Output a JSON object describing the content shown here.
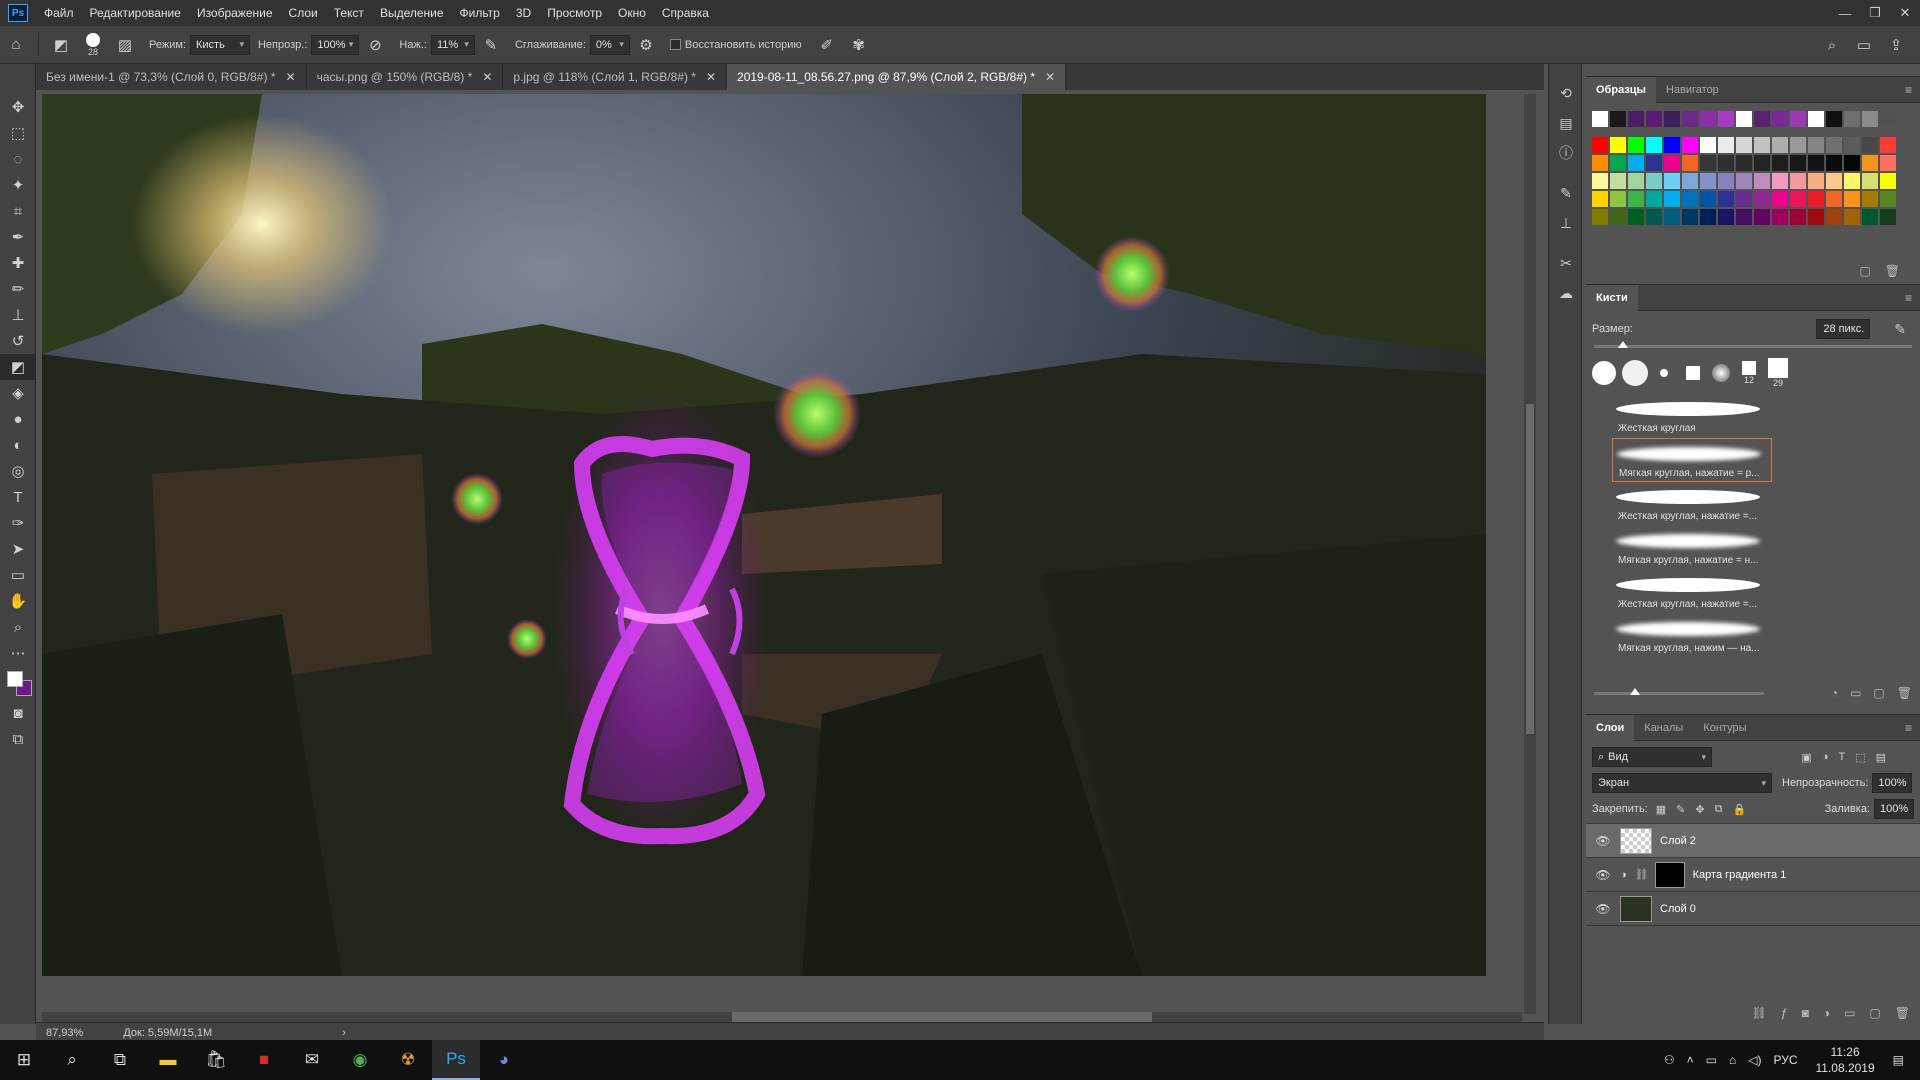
{
  "app": {
    "logo": "Ps"
  },
  "menu": [
    "Файл",
    "Редактирование",
    "Изображение",
    "Слои",
    "Текст",
    "Выделение",
    "Фильтр",
    "3D",
    "Просмотр",
    "Окно",
    "Справка"
  ],
  "window_controls": {
    "minimize": "—",
    "restore": "❐",
    "close": "✕"
  },
  "options": {
    "brush_size": "28",
    "mode_label": "Режим:",
    "mode_value": "Кисть",
    "opacity_label": "Непрозр.:",
    "opacity_value": "100%",
    "pressure_label": "Наж.:",
    "pressure_value": "11%",
    "smoothing_label": "Сглаживание:",
    "smoothing_value": "0%",
    "restore_history": "Восстановить историю"
  },
  "tabs": [
    {
      "label": "Без имени-1 @ 73,3% (Слой 0, RGB/8#) *",
      "active": false
    },
    {
      "label": "часы.png @ 150% (RGB/8) *",
      "active": false
    },
    {
      "label": "p.jpg @ 118% (Слой 1, RGB/8#) *",
      "active": false
    },
    {
      "label": "2019-08-11_08.56.27.png @ 87,9% (Слой 2, RGB/8#) *",
      "active": true
    }
  ],
  "status": {
    "zoom": "87,93%",
    "doc": "Док: 5,59M/15,1M"
  },
  "swatches_panel": {
    "tabs": [
      "Образцы",
      "Навигатор"
    ]
  },
  "swatch_rows": [
    [
      "#ffffff",
      "#1a1a1a",
      "#4b1e63",
      "#5a1a78",
      "#3c1e5a",
      "#6b2a86",
      "#8a2fa8",
      "#a33cc2",
      "#ffffff",
      "#5c2070",
      "#7a2a96",
      "#9a3ab6",
      "#ffffff",
      "#101010",
      "#6e6e6e",
      "#8a8a8a",
      "#505050"
    ],
    [
      "#ff0000",
      "#ffff00",
      "#00ff00",
      "#00ffff",
      "#0000ff",
      "#ff00ff",
      "#ffffff",
      "#ebebeb",
      "#d6d6d6",
      "#c2c2c2",
      "#adadad",
      "#999999",
      "#858585",
      "#707070",
      "#5c5c5c",
      "#474747",
      "#ff3b3b"
    ],
    [
      "#ff8c00",
      "#00a651",
      "#00aeef",
      "#2e3192",
      "#ec008c",
      "#f26522",
      "#363636",
      "#303030",
      "#2a2a2a",
      "#242424",
      "#1e1e1e",
      "#181818",
      "#121212",
      "#0c0c0c",
      "#060606",
      "#f7941d",
      "#ff6f61"
    ],
    [
      "#fff799",
      "#c4df9b",
      "#a3d39c",
      "#7accc8",
      "#6dcff6",
      "#7da7d9",
      "#8393ca",
      "#8781bd",
      "#a186be",
      "#bd8cbf",
      "#f49ac1",
      "#f5989d",
      "#f9ad81",
      "#fdc68a",
      "#fff568",
      "#d6e070",
      "#f6ff00"
    ],
    [
      "#ffd400",
      "#8dc63f",
      "#39b54a",
      "#00a99d",
      "#00aeef",
      "#0072bc",
      "#0054a6",
      "#2e3192",
      "#662d91",
      "#92278f",
      "#ec008c",
      "#ed145b",
      "#ed1c24",
      "#f26522",
      "#f7941d",
      "#a37c00",
      "#598527"
    ],
    [
      "#827b00",
      "#406618",
      "#005e20",
      "#005952",
      "#005b7f",
      "#003663",
      "#002157",
      "#1b1464",
      "#440e62",
      "#630460",
      "#9e005d",
      "#9e0039",
      "#9e0b0f",
      "#a0410d",
      "#a36209",
      "#00592e",
      "#163d1b"
    ]
  ],
  "brushes_panel": {
    "title": "Кисти",
    "size_label": "Размер:",
    "size_value": "28 пикс.",
    "preset_numbers": [
      "12",
      "29"
    ],
    "presets": [
      "Жесткая круглая",
      "Мягкая круглая, нажатие = р...",
      "Жесткая круглая, нажатие =...",
      "Мягкая круглая, нажатие = н...",
      "Жесткая круглая, нажатие =...",
      "Мягкая круглая, нажим — на..."
    ]
  },
  "layers_panel": {
    "tabs": [
      "Слои",
      "Каналы",
      "Контуры"
    ],
    "filter_value": "Вид",
    "blend_mode": "Экран",
    "opacity_label": "Непрозрачность:",
    "opacity_value": "100%",
    "lock_label": "Закрепить:",
    "fill_label": "Заливка:",
    "fill_value": "100%",
    "layers": [
      "Слой 2",
      "Карта градиента 1",
      "Слой 0"
    ]
  },
  "taskbar": {
    "lang": "РУС",
    "time": "11:26",
    "date": "11.08.2019"
  }
}
